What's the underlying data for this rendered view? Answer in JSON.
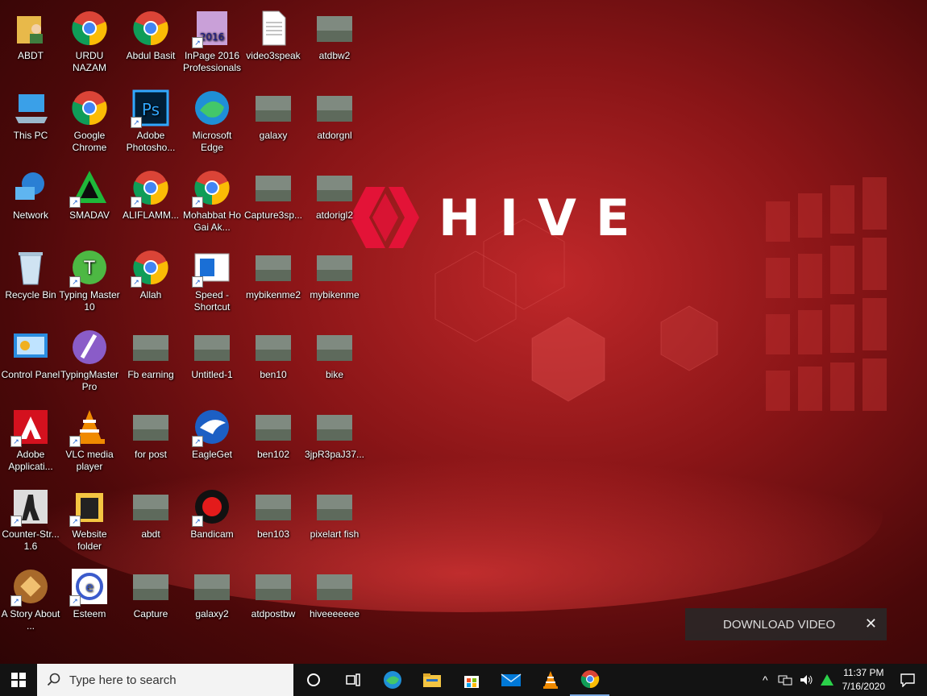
{
  "wallpaper": {
    "brand": "HIVE"
  },
  "desktop": {
    "icons": [
      {
        "label": "ABDT",
        "icon": "user-folder-icon"
      },
      {
        "label": "URDU NAZAM",
        "icon": "chrome-icon"
      },
      {
        "label": "Abdul Basit",
        "icon": "chrome-icon"
      },
      {
        "label": "InPage 2016 Professionals",
        "icon": "inpage-icon"
      },
      {
        "label": "video3speak",
        "icon": "text-document-icon"
      },
      {
        "label": "atdbw2",
        "icon": "image-thumbnail-icon"
      },
      {
        "label": "This PC",
        "icon": "computer-icon"
      },
      {
        "label": "Google Chrome",
        "icon": "chrome-icon"
      },
      {
        "label": "Adobe Photosho...",
        "icon": "photoshop-icon"
      },
      {
        "label": "Microsoft Edge",
        "icon": "edge-icon"
      },
      {
        "label": "galaxy",
        "icon": "image-thumbnail-icon"
      },
      {
        "label": "atdorgnl",
        "icon": "image-thumbnail-icon"
      },
      {
        "label": "Network",
        "icon": "network-icon"
      },
      {
        "label": "SMADAV",
        "icon": "smadav-icon"
      },
      {
        "label": "ALIFLAMM...",
        "icon": "chrome-icon"
      },
      {
        "label": "Mohabbat Ho Gai Ak...",
        "icon": "chrome-icon"
      },
      {
        "label": "Capture3sp...",
        "icon": "image-thumbnail-icon"
      },
      {
        "label": "atdorigl2",
        "icon": "image-thumbnail-icon"
      },
      {
        "label": "Recycle Bin",
        "icon": "recycle-bin-icon"
      },
      {
        "label": "Typing Master 10",
        "icon": "typing-master-icon"
      },
      {
        "label": "Allah",
        "icon": "chrome-icon"
      },
      {
        "label": "Speed - Shortcut",
        "icon": "shortcut-document-icon"
      },
      {
        "label": "mybikenme2",
        "icon": "image-thumbnail-icon"
      },
      {
        "label": "mybikenme",
        "icon": "image-thumbnail-icon"
      },
      {
        "label": "Control Panel",
        "icon": "control-panel-icon"
      },
      {
        "label": "TypingMaster Pro",
        "icon": "typing-master-pro-icon"
      },
      {
        "label": "Fb earning",
        "icon": "image-thumbnail-icon"
      },
      {
        "label": "Untitled-1",
        "icon": "image-thumbnail-icon"
      },
      {
        "label": "ben10",
        "icon": "image-thumbnail-icon"
      },
      {
        "label": "bike",
        "icon": "image-thumbnail-icon"
      },
      {
        "label": "Adobe Applicati...",
        "icon": "adobe-icon"
      },
      {
        "label": "VLC media player",
        "icon": "vlc-icon"
      },
      {
        "label": "for post",
        "icon": "image-thumbnail-icon"
      },
      {
        "label": "EagleGet",
        "icon": "eagleget-icon"
      },
      {
        "label": "ben102",
        "icon": "image-thumbnail-icon"
      },
      {
        "label": "3jpR3paJ37...",
        "icon": "image-thumbnail-icon"
      },
      {
        "label": "Counter-Str... 1.6",
        "icon": "counter-strike-icon"
      },
      {
        "label": "Website folder",
        "icon": "folder-icon"
      },
      {
        "label": "abdt",
        "icon": "image-thumbnail-icon"
      },
      {
        "label": "Bandicam",
        "icon": "bandicam-icon"
      },
      {
        "label": "ben103",
        "icon": "image-thumbnail-icon"
      },
      {
        "label": "pixelart fish",
        "icon": "image-thumbnail-icon"
      },
      {
        "label": "A Story About ...",
        "icon": "game-shortcut-icon"
      },
      {
        "label": "Esteem",
        "icon": "esteem-icon"
      },
      {
        "label": "Capture",
        "icon": "image-thumbnail-icon"
      },
      {
        "label": "galaxy2",
        "icon": "image-thumbnail-icon"
      },
      {
        "label": "atdpostbw",
        "icon": "image-thumbnail-icon"
      },
      {
        "label": "hiveeeeeee",
        "icon": "image-thumbnail-icon"
      }
    ]
  },
  "download_banner": {
    "label": "DOWNLOAD VIDEO",
    "close_icon": "close-icon"
  },
  "taskbar": {
    "search_placeholder": "Type here to search",
    "pinned": [
      "cortana-icon",
      "task-view-icon",
      "edge-icon",
      "file-explorer-icon",
      "store-icon",
      "mail-icon",
      "vlc-icon",
      "chrome-icon"
    ],
    "tray_icons": [
      "chevron-up-icon",
      "network-icon",
      "volume-icon",
      "smadav-tray-icon"
    ],
    "time": "11:37 PM",
    "date": "7/16/2020"
  },
  "colors": {
    "accent": "#d32f2f",
    "taskbar": "#131313"
  }
}
